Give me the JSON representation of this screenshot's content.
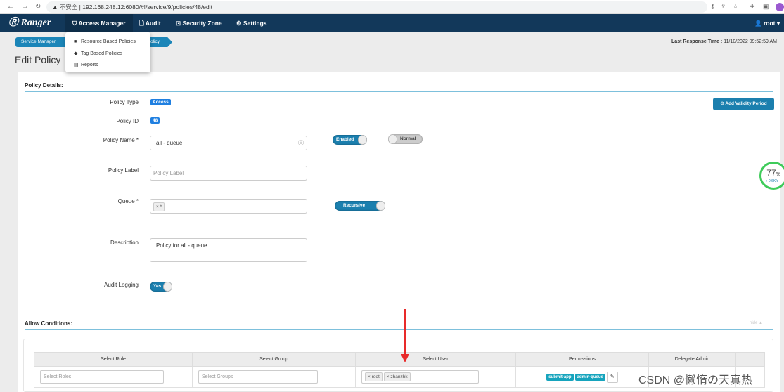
{
  "browser": {
    "url_warning": "不安全",
    "url": "192.168.248.12:6080/#!/service/9/policies/48/edit"
  },
  "navbar": {
    "brand": "Ranger",
    "items": [
      "Access Manager",
      "Audit",
      "Security Zone",
      "Settings"
    ],
    "user": "root"
  },
  "dropdown": {
    "items": [
      "Resource Based Policies",
      "Tag Based Policies",
      "Reports"
    ]
  },
  "breadcrumb": [
    "Service Manager",
    "olicy"
  ],
  "last_response": {
    "label": "Last Response Time :",
    "value": "11/10/2022 09:52:59 AM"
  },
  "page_title": "Edit Policy",
  "policy_details": {
    "heading": "Policy Details:",
    "policy_type_label": "Policy Type",
    "policy_type": "Access",
    "policy_id_label": "Policy ID",
    "policy_id": "48",
    "policy_name_label": "Policy Name *",
    "policy_name": "all - queue",
    "enabled": "Enabled",
    "normal": "Normal",
    "policy_label_label": "Policy Label",
    "policy_label_placeholder": "Policy Label",
    "queue_label": "Queue *",
    "queue_value": "× *",
    "recursive": "Recursive",
    "description_label": "Description",
    "description": "Policy for all - queue",
    "audit_label": "Audit Logging",
    "audit_value": "Yes",
    "add_validity": "Add Validity Period"
  },
  "gauge": {
    "percent": "77",
    "unit": "%",
    "rate": "↑ 0.6K/s"
  },
  "allow_conditions": {
    "heading": "Allow Conditions:",
    "hide": "hide ▲",
    "columns": [
      "Select Role",
      "Select Group",
      "Select User",
      "Permissions",
      "Delegate Admin"
    ],
    "row": {
      "roles_placeholder": "Select Roles",
      "groups_placeholder": "Select Groups",
      "users": [
        "× root",
        "× zhanzhk"
      ],
      "permissions": [
        "submit-app",
        "admin-queue"
      ]
    }
  },
  "watermark": "CSDN @懒惰の天真热",
  "colors": {
    "navbar": "#12385a",
    "accent": "#1b7fae",
    "badge": "#1f7fe0",
    "permission": "#16a4bd",
    "arrow": "#e82a2a"
  }
}
